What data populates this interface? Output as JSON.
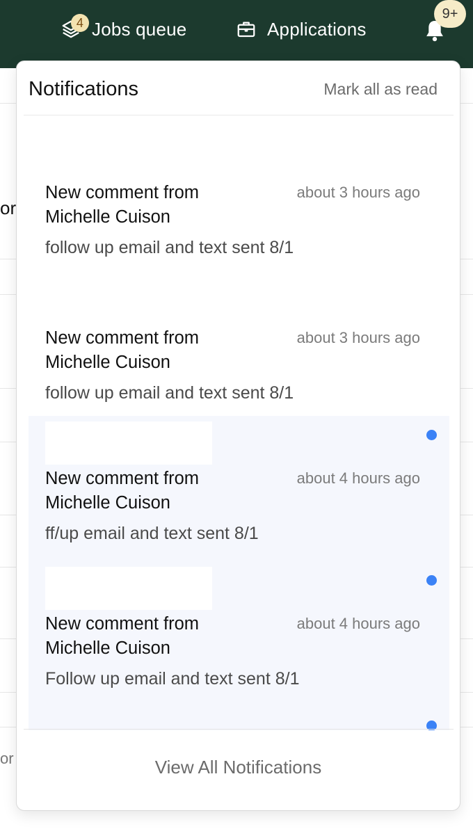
{
  "nav": {
    "jobs": {
      "label": "Jobs queue",
      "badge": "4",
      "icon": "layers-icon"
    },
    "applications": {
      "label": "Applications",
      "icon": "briefcase-icon"
    },
    "notifications": {
      "badge": "9+",
      "icon": "bell-icon"
    }
  },
  "background": {
    "partial_text_1": "or",
    "partial_text_2": "or"
  },
  "panel": {
    "title": "Notifications",
    "mark_all_label": "Mark all as read",
    "view_all_label": "View All Notifications",
    "items": [
      {
        "heading": "New comment from Michelle Cuison",
        "time": "about 3 hours ago",
        "body": "follow up email and text sent 8/1",
        "unread": false
      },
      {
        "heading": "New comment from Michelle Cuison",
        "time": "about 3 hours ago",
        "body": "follow up email and text sent 8/1",
        "unread": false
      },
      {
        "heading": "New comment from Michelle Cuison",
        "time": "about 4 hours ago",
        "body": "ff/up email and text sent 8/1",
        "unread": true
      },
      {
        "heading": "New comment from Michelle Cuison",
        "time": "about 4 hours ago",
        "body": "Follow up email and text sent 8/1",
        "unread": true
      }
    ]
  },
  "colors": {
    "topbar": "#1c3a2e",
    "unread_bg": "#f5f7fd",
    "unread_dot": "#3b82f6"
  }
}
